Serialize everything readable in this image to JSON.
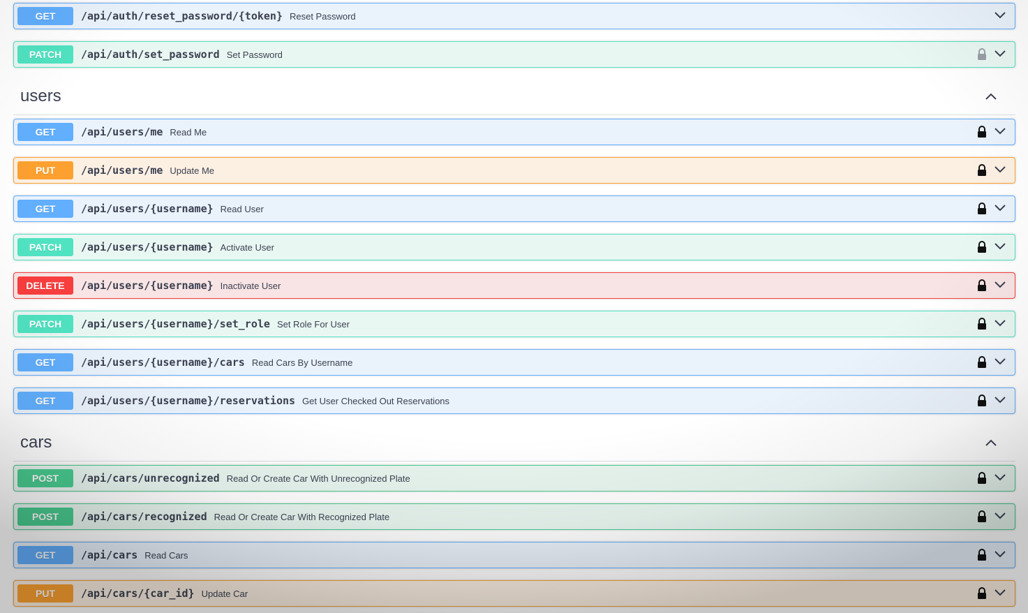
{
  "sections": [
    {
      "name": "",
      "operations": [
        {
          "method": "GET",
          "path": "/api/auth/reset_password/{token}",
          "summary": "Reset Password",
          "locked": false
        },
        {
          "method": "PATCH",
          "path": "/api/auth/set_password",
          "summary": "Set Password",
          "locked": true,
          "lock_dim": true
        }
      ]
    },
    {
      "name": "users",
      "operations": [
        {
          "method": "GET",
          "path": "/api/users/me",
          "summary": "Read Me",
          "locked": true
        },
        {
          "method": "PUT",
          "path": "/api/users/me",
          "summary": "Update Me",
          "locked": true
        },
        {
          "method": "GET",
          "path": "/api/users/{username}",
          "summary": "Read User",
          "locked": true
        },
        {
          "method": "PATCH",
          "path": "/api/users/{username}",
          "summary": "Activate User",
          "locked": true
        },
        {
          "method": "DELETE",
          "path": "/api/users/{username}",
          "summary": "Inactivate User",
          "locked": true
        },
        {
          "method": "PATCH",
          "path": "/api/users/{username}/set_role",
          "summary": "Set Role For User",
          "locked": true
        },
        {
          "method": "GET",
          "path": "/api/users/{username}/cars",
          "summary": "Read Cars By Username",
          "locked": true
        },
        {
          "method": "GET",
          "path": "/api/users/{username}/reservations",
          "summary": "Get User Checked Out Reservations",
          "locked": true
        }
      ]
    },
    {
      "name": "cars",
      "operations": [
        {
          "method": "POST",
          "path": "/api/cars/unrecognized",
          "summary": "Read Or Create Car With Unrecognized Plate",
          "locked": true
        },
        {
          "method": "POST",
          "path": "/api/cars/recognized",
          "summary": "Read Or Create Car With Recognized Plate",
          "locked": true
        },
        {
          "method": "GET",
          "path": "/api/cars",
          "summary": "Read Cars",
          "locked": true
        },
        {
          "method": "PUT",
          "path": "/api/cars/{car_id}",
          "summary": "Update Car",
          "locked": true
        }
      ]
    }
  ],
  "colors": {
    "GET": "#61affe",
    "PATCH": "#50e3c2",
    "PUT": "#fca130",
    "DELETE": "#f93e3e",
    "POST": "#49cc90",
    "text": "#3b4151"
  },
  "icons": {
    "lock": "lock-icon",
    "expand": "chevron-down-icon",
    "collapse": "chevron-up-icon"
  }
}
